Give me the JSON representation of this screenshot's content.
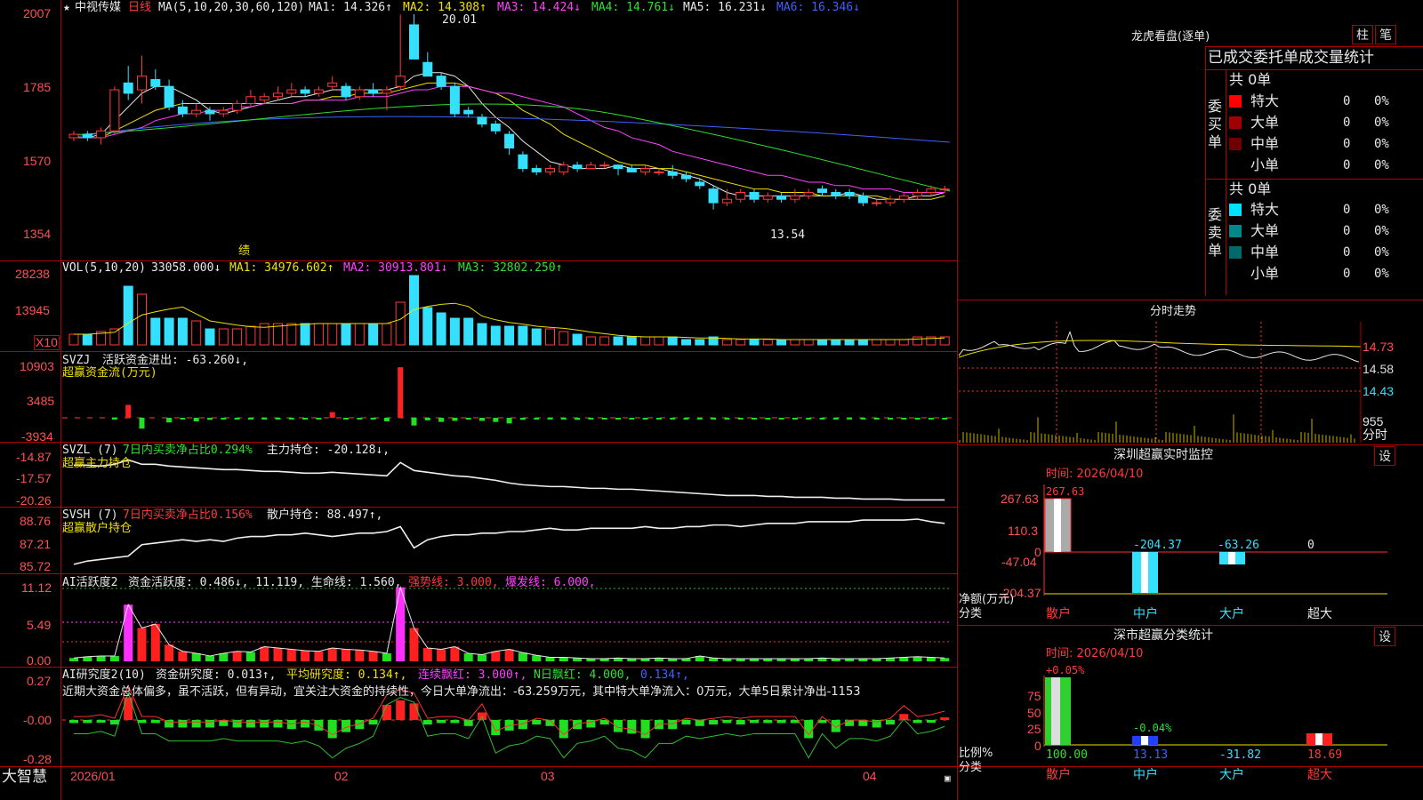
{
  "brand": "大智慧",
  "header": {
    "star": "★",
    "stock": "中视传媒",
    "period": "日线",
    "ma_label": "MA(5,10,20,30,60,120)",
    "ma1": "MA1: 14.326↑",
    "ma2": "MA2: 14.308↑",
    "ma3": "MA3: 14.424↓",
    "ma4": "MA4: 14.761↓",
    "ma5": "MA5: 16.231↓",
    "ma6": "MA6: 16.346↓"
  },
  "price_axis": [
    "2007",
    "1785",
    "1570",
    "1354"
  ],
  "price_high": "20.01",
  "price_low": "13.54",
  "earn_mark": "绩",
  "vol": {
    "label": "VOL(5,10,20)",
    "v": "33058.000↓",
    "ma1": "MA1: 34976.602↑",
    "ma2": "MA2: 30913.801↓",
    "ma3": "MA3: 32802.250↑",
    "axis": [
      "28238",
      "13945"
    ],
    "unit": "X10"
  },
  "svzj": {
    "l1a": "SVZJ",
    "l1b": "活跃资金进出: -63.260↓,",
    "l2": "超赢资金流(万元)",
    "axis": [
      "10903",
      "3485",
      "-3934"
    ]
  },
  "svzl": {
    "l1a": "SVZL (7)",
    "l1b": "7日内买卖净占比0.294%",
    "l1c": "主力持仓: -20.128↓,",
    "l2": "超赢主力持仓",
    "axis": [
      "-14.87",
      "-17.57",
      "-20.26"
    ]
  },
  "svsh": {
    "l1a": "SVSH (7)",
    "l1b": "7日内买卖净占比0.156%",
    "l1c": "散户持仓: 88.497↑,",
    "l2": "超赢散户持仓",
    "axis": [
      "88.76",
      "87.21",
      "85.72"
    ]
  },
  "ai1": {
    "a": "AI活跃度2",
    "b": "资金活跃度: 0.486↓, 11.119, 生命线: 1.560,",
    "c": "强势线: 3.000,",
    "d": "爆发线: 6.000,",
    "axis": [
      "11.12",
      "5.49",
      "0.00"
    ]
  },
  "ai2": {
    "a": "AI研究度2(10)",
    "b": "资金研究度: 0.013↑,",
    "c": "平均研究度: 0.134↑,",
    "d": "连续飘红: 3.000↑,",
    "e": "N日飘红: 4.000,",
    "f": "0.134↑,",
    "axis": [
      "0.27",
      "-0.00",
      "-0.28"
    ],
    "comment": "近期大资金总体偏多，虽不活跃，但有异动，宜关注大资金的持续性，今日大单净流出：-63.259万元，其中特大单净流入：0万元，大单5日累计净出-1153"
  },
  "dates": [
    "2026/01",
    "02",
    "03",
    "04"
  ],
  "dragon": {
    "title": "龙虎看盘(逐单)",
    "btn1": "柱",
    "btn2": "笔",
    "head": "已成交委托单成交量统计",
    "buy": {
      "total": "共 0单",
      "side": "委买单",
      "rows": [
        {
          "name": "特大",
          "count": "0",
          "pct": "0%",
          "color": "#ff0000"
        },
        {
          "name": "大单",
          "count": "0",
          "pct": "0%",
          "color": "#a00000"
        },
        {
          "name": "中单",
          "count": "0",
          "pct": "0%",
          "color": "#700000"
        },
        {
          "name": "小单",
          "count": "0",
          "pct": "0%",
          "color": ""
        }
      ]
    },
    "sell": {
      "total": "共 0单",
      "side": "委卖单",
      "rows": [
        {
          "name": "特大",
          "count": "0",
          "pct": "0%",
          "color": "#00e0ff"
        },
        {
          "name": "大单",
          "count": "0",
          "pct": "0%",
          "color": "#008888"
        },
        {
          "name": "中单",
          "count": "0",
          "pct": "0%",
          "color": "#006a6a"
        },
        {
          "name": "小单",
          "count": "0",
          "pct": "0%",
          "color": ""
        }
      ]
    }
  },
  "intraday": {
    "title": "分时走势",
    "axis": [
      "14.73",
      "14.58",
      "14.43"
    ],
    "vol": "955",
    "tag": "分时"
  },
  "monitor": {
    "title": "深圳超赢实时监控",
    "btn": "设",
    "time": "时间: 2026/04/10",
    "axis": [
      "267.63",
      "110.3",
      "0",
      "-47.04",
      "-204.37"
    ],
    "ylabel1": "净额(万元)",
    "ylabel2": "分类",
    "cats": [
      "散户",
      "中户",
      "大户",
      "超大"
    ],
    "vals": [
      "267.63",
      "-204.37",
      "-63.26",
      "0"
    ]
  },
  "classify": {
    "title": "深市超赢分类统计",
    "btn": "设",
    "time": "时间: 2026/04/10",
    "axis": [
      "75",
      "50",
      "25",
      "0"
    ],
    "ylabel1": "比例%",
    "ylabel2": "分类",
    "top": [
      "+0.05%",
      "-0.04%"
    ],
    "bottom": [
      "100.00",
      "13.13",
      "-31.82",
      "18.69"
    ],
    "cats": [
      "散户",
      "中户",
      "大户",
      "超大"
    ]
  },
  "chart_data": [
    {
      "type": "candlestick",
      "name": "中视传媒 日线",
      "x_start": "2026/01",
      "y_range": [
        13.54,
        20.01
      ],
      "candles": [
        [
          16.4,
          16.6,
          16.3,
          16.5
        ],
        [
          16.5,
          16.6,
          16.3,
          16.4
        ],
        [
          16.4,
          16.7,
          16.2,
          16.6
        ],
        [
          16.6,
          17.9,
          16.5,
          17.8
        ],
        [
          18.0,
          18.5,
          17.5,
          17.7
        ],
        [
          17.8,
          18.8,
          17.4,
          18.2
        ],
        [
          18.1,
          18.4,
          17.8,
          17.9
        ],
        [
          17.9,
          18.1,
          17.2,
          17.3
        ],
        [
          17.3,
          17.5,
          17.0,
          17.1
        ],
        [
          17.1,
          17.4,
          17.0,
          17.2
        ],
        [
          17.2,
          17.3,
          16.9,
          17.1
        ],
        [
          17.1,
          17.3,
          17.0,
          17.2
        ],
        [
          17.2,
          17.5,
          17.1,
          17.4
        ],
        [
          17.4,
          17.8,
          17.3,
          17.6
        ],
        [
          17.5,
          17.7,
          17.4,
          17.6
        ],
        [
          17.6,
          17.9,
          17.5,
          17.7
        ],
        [
          17.7,
          18.0,
          17.6,
          17.8
        ],
        [
          17.8,
          17.9,
          17.6,
          17.7
        ],
        [
          17.7,
          17.9,
          17.6,
          17.8
        ],
        [
          17.9,
          18.2,
          17.8,
          18.0
        ],
        [
          17.9,
          18.0,
          17.5,
          17.6
        ],
        [
          17.6,
          17.9,
          17.5,
          17.8
        ],
        [
          17.8,
          18.0,
          17.6,
          17.7
        ],
        [
          17.7,
          17.9,
          17.2,
          17.8
        ],
        [
          17.9,
          20.0,
          17.8,
          18.2
        ],
        [
          19.7,
          20.01,
          18.7,
          18.7
        ],
        [
          18.6,
          18.9,
          18.2,
          18.2
        ],
        [
          18.2,
          18.3,
          17.8,
          17.9
        ],
        [
          17.9,
          18.0,
          17.0,
          17.1
        ],
        [
          17.2,
          17.3,
          17.0,
          17.1
        ],
        [
          17.0,
          17.1,
          16.7,
          16.8
        ],
        [
          16.8,
          16.9,
          16.5,
          16.6
        ],
        [
          16.5,
          16.6,
          15.9,
          16.1
        ],
        [
          15.9,
          16.0,
          15.4,
          15.5
        ],
        [
          15.5,
          15.6,
          15.3,
          15.4
        ],
        [
          15.4,
          15.6,
          15.3,
          15.5
        ],
        [
          15.4,
          15.7,
          15.3,
          15.6
        ],
        [
          15.6,
          15.7,
          15.4,
          15.5
        ],
        [
          15.5,
          15.7,
          15.5,
          15.6
        ],
        [
          15.6,
          15.7,
          15.5,
          15.6
        ],
        [
          15.6,
          15.6,
          15.3,
          15.5
        ],
        [
          15.5,
          15.6,
          15.4,
          15.4
        ],
        [
          15.4,
          15.6,
          15.3,
          15.5
        ],
        [
          15.4,
          15.5,
          15.3,
          15.4
        ],
        [
          15.4,
          15.6,
          15.2,
          15.3
        ],
        [
          15.3,
          15.4,
          15.1,
          15.2
        ],
        [
          15.1,
          15.2,
          14.9,
          15.0
        ],
        [
          14.9,
          15.0,
          14.3,
          14.5
        ],
        [
          14.5,
          14.9,
          14.4,
          14.6
        ],
        [
          14.6,
          14.9,
          14.5,
          14.8
        ],
        [
          14.8,
          14.9,
          14.5,
          14.6
        ],
        [
          14.6,
          14.8,
          14.5,
          14.7
        ],
        [
          14.7,
          14.8,
          14.5,
          14.6
        ],
        [
          14.6,
          14.9,
          14.5,
          14.7
        ],
        [
          14.7,
          14.9,
          14.6,
          14.8
        ],
        [
          14.9,
          15.0,
          14.7,
          14.8
        ],
        [
          14.8,
          14.9,
          14.6,
          14.7
        ],
        [
          14.8,
          14.9,
          14.6,
          14.7
        ],
        [
          14.7,
          14.8,
          14.4,
          14.5
        ],
        [
          14.5,
          14.6,
          14.4,
          14.5
        ],
        [
          14.5,
          14.7,
          14.4,
          14.6
        ],
        [
          14.6,
          14.8,
          14.5,
          14.7
        ],
        [
          14.7,
          14.9,
          14.6,
          14.8
        ],
        [
          14.8,
          15.0,
          14.7,
          14.9
        ],
        [
          14.9,
          15.0,
          14.8,
          14.9
        ]
      ],
      "ma_lines": {
        "MA1": [
          16.4,
          16.4,
          16.5,
          16.9,
          17.3,
          17.7,
          17.9,
          17.9,
          17.7,
          17.5,
          17.2,
          17.1,
          17.2,
          17.3,
          17.4,
          17.5,
          17.6,
          17.6,
          17.7,
          17.8,
          17.8,
          17.8,
          17.8,
          17.8,
          17.9,
          18.2,
          18.3,
          18.3,
          18.2,
          17.9,
          17.4,
          17.0,
          16.7,
          16.3,
          16.0,
          15.7,
          15.6,
          15.5,
          15.5,
          15.5,
          15.6,
          15.5,
          15.5,
          15.5,
          15.4,
          15.3,
          15.2,
          15.0,
          14.8,
          14.7,
          14.7,
          14.7,
          14.7,
          14.7,
          14.7,
          14.7,
          14.7,
          14.8,
          14.7,
          14.6,
          14.6,
          14.6,
          14.7,
          14.7,
          14.8
        ],
        "MA2": [
          16.4,
          16.4,
          16.4,
          16.6,
          16.8,
          17.0,
          17.2,
          17.3,
          17.4,
          17.4,
          17.4,
          17.4,
          17.4,
          17.4,
          17.4,
          17.4,
          17.4,
          17.5,
          17.5,
          17.6,
          17.6,
          17.7,
          17.7,
          17.7,
          17.8,
          17.9,
          18.0,
          18.0,
          18.0,
          17.9,
          17.8,
          17.7,
          17.5,
          17.2,
          17.0,
          16.8,
          16.5,
          16.3,
          16.1,
          15.9,
          15.7,
          15.6,
          15.6,
          15.5,
          15.5,
          15.4,
          15.3,
          15.2,
          15.1,
          15.0,
          14.9,
          14.9,
          14.8,
          14.8,
          14.8,
          14.7,
          14.7,
          14.7,
          14.7,
          14.7,
          14.6,
          14.6,
          14.6,
          14.6,
          14.7
        ],
        "MA3": [
          16.4,
          16.4,
          16.4,
          16.5,
          16.6,
          16.7,
          16.9,
          17.0,
          17.1,
          17.1,
          17.2,
          17.2,
          17.3,
          17.3,
          17.4,
          17.4,
          17.4,
          17.5,
          17.5,
          17.5,
          17.5,
          17.6,
          17.6,
          17.6,
          17.7,
          17.8,
          17.8,
          17.9,
          17.9,
          17.9,
          17.8,
          17.7,
          17.7,
          17.6,
          17.5,
          17.4,
          17.3,
          17.1,
          16.9,
          16.7,
          16.6,
          16.4,
          16.3,
          16.2,
          16.0,
          15.9,
          15.8,
          15.7,
          15.6,
          15.5,
          15.4,
          15.3,
          15.3,
          15.2,
          15.1,
          15.1,
          15.0,
          15.0,
          14.9,
          14.9,
          14.9,
          14.8,
          14.8,
          14.8,
          14.8
        ]
      }
    },
    {
      "type": "bar",
      "name": "VOL(5,10,20)",
      "axis_ticks": [
        "28238",
        "13945"
      ],
      "values": [
        4,
        4,
        5,
        6,
        22,
        19,
        10,
        10,
        10,
        9,
        6,
        6,
        6,
        7,
        8,
        8,
        8,
        8,
        8,
        8,
        8,
        8,
        8,
        8,
        16,
        26,
        14,
        12,
        10,
        10,
        8,
        7,
        7,
        7,
        6,
        6,
        5,
        4,
        3,
        3,
        3,
        3,
        3,
        3,
        3,
        2,
        2,
        3,
        2,
        2,
        2,
        2,
        2,
        2,
        2,
        2,
        2,
        2,
        2,
        2,
        2,
        2,
        3,
        3,
        3
      ],
      "unit": "X10"
    },
    {
      "type": "bar",
      "name": "超赢资金流(万元)",
      "axis_ticks": [
        "10903",
        "3485",
        "-3934"
      ],
      "values": [
        0,
        0,
        0,
        -50,
        2500,
        -2100,
        0,
        -900,
        -300,
        -700,
        -400,
        -200,
        -300,
        -100,
        -200,
        -300,
        -200,
        -300,
        -200,
        1100,
        -300,
        -200,
        -100,
        -700,
        9800,
        -1500,
        -500,
        -800,
        -600,
        -300,
        -600,
        -800,
        -1100,
        -400,
        -300,
        -300,
        -200,
        -400,
        -200,
        -100,
        -200,
        -100,
        -200,
        -100,
        -100,
        -100,
        -200,
        -100,
        -100,
        -100,
        -100,
        -100,
        -100,
        -100,
        -200,
        -100,
        -100,
        -100,
        -100,
        -100,
        -100,
        -100,
        -100,
        -100,
        -63
      ]
    },
    {
      "type": "line",
      "name": "超赢主力持仓",
      "axis_ticks": [
        "-14.87",
        "-17.57",
        "-20.26"
      ],
      "values": [
        -16.2,
        -16.2,
        -16.3,
        -16.1,
        -15.6,
        -16.1,
        -16.1,
        -16.3,
        -16.4,
        -16.5,
        -16.6,
        -16.7,
        -16.7,
        -16.8,
        -16.9,
        -16.9,
        -17.0,
        -17.1,
        -17.1,
        -17.0,
        -17.1,
        -17.2,
        -17.3,
        -17.4,
        -15.9,
        -16.8,
        -17.0,
        -17.2,
        -17.4,
        -17.5,
        -17.7,
        -17.9,
        -18.2,
        -18.4,
        -18.5,
        -18.6,
        -18.6,
        -18.7,
        -18.8,
        -18.8,
        -18.9,
        -18.9,
        -19.0,
        -19.1,
        -19.2,
        -19.3,
        -19.4,
        -19.5,
        -19.6,
        -19.6,
        -19.6,
        -19.7,
        -19.7,
        -19.8,
        -19.8,
        -19.8,
        -19.9,
        -19.9,
        -20.0,
        -20.0,
        -20.0,
        -20.1,
        -20.1,
        -20.1,
        -20.1
      ]
    },
    {
      "type": "line",
      "name": "超赢散户持仓",
      "axis_ticks": [
        "88.76",
        "87.21",
        "85.72"
      ],
      "values": [
        86.0,
        86.2,
        86.3,
        86.4,
        86.5,
        87.2,
        87.3,
        87.4,
        87.5,
        87.4,
        87.5,
        87.4,
        87.6,
        87.7,
        87.7,
        87.8,
        87.8,
        87.9,
        87.8,
        87.7,
        87.8,
        87.9,
        87.9,
        88.0,
        88.3,
        87.0,
        87.5,
        87.7,
        87.8,
        87.8,
        87.9,
        87.9,
        88.0,
        88.0,
        88.1,
        88.2,
        88.1,
        88.1,
        88.2,
        88.2,
        88.2,
        88.2,
        88.3,
        88.2,
        88.2,
        88.3,
        88.3,
        88.4,
        88.4,
        88.3,
        88.4,
        88.5,
        88.5,
        88.5,
        88.6,
        88.6,
        88.6,
        88.6,
        88.7,
        88.7,
        88.7,
        88.7,
        88.76,
        88.6,
        88.5
      ]
    },
    {
      "type": "bar",
      "name": "AI活跃度2",
      "axis_ticks": [
        "11.12",
        "5.49",
        "0.00"
      ],
      "values": [
        0.5,
        0.7,
        0.8,
        0.8,
        8.5,
        5.0,
        5.6,
        2.5,
        1.5,
        1.2,
        0.8,
        1.2,
        1.5,
        1.4,
        2.2,
        2.0,
        1.8,
        1.6,
        1.5,
        2.0,
        1.8,
        1.7,
        1.5,
        1.2,
        11.1,
        5.0,
        2.0,
        1.8,
        2.2,
        1.2,
        1.0,
        1.5,
        1.8,
        1.3,
        0.9,
        0.6,
        0.6,
        0.5,
        0.4,
        0.4,
        0.5,
        0.4,
        0.4,
        0.5,
        0.4,
        0.4,
        0.8,
        0.5,
        0.4,
        0.4,
        0.4,
        0.4,
        0.4,
        0.4,
        0.4,
        0.5,
        0.4,
        0.4,
        0.4,
        0.4,
        0.5,
        0.6,
        0.7,
        0.6,
        0.5
      ]
    },
    {
      "type": "bar",
      "name": "AI研究度2(10)",
      "axis_ticks": [
        "0.27",
        "-0.00",
        "-0.28"
      ],
      "values": [
        -0.02,
        -0.02,
        -0.01,
        -0.03,
        0.15,
        -0.02,
        -0.02,
        -0.05,
        -0.05,
        -0.05,
        -0.05,
        -0.04,
        -0.05,
        -0.05,
        -0.05,
        -0.05,
        -0.06,
        -0.05,
        -0.07,
        -0.12,
        -0.08,
        -0.06,
        -0.03,
        0.1,
        0.13,
        0.11,
        -0.03,
        -0.02,
        -0.02,
        -0.04,
        0.05,
        -0.1,
        -0.07,
        -0.06,
        -0.03,
        -0.04,
        -0.12,
        -0.06,
        -0.05,
        -0.03,
        -0.08,
        -0.09,
        -0.12,
        -0.06,
        -0.06,
        -0.03,
        -0.04,
        -0.03,
        -0.02,
        -0.03,
        -0.02,
        -0.02,
        -0.02,
        -0.02,
        -0.12,
        -0.02,
        -0.08,
        -0.04,
        -0.04,
        -0.05,
        -0.03,
        0.04,
        -0.02,
        -0.01,
        0.01
      ]
    }
  ]
}
